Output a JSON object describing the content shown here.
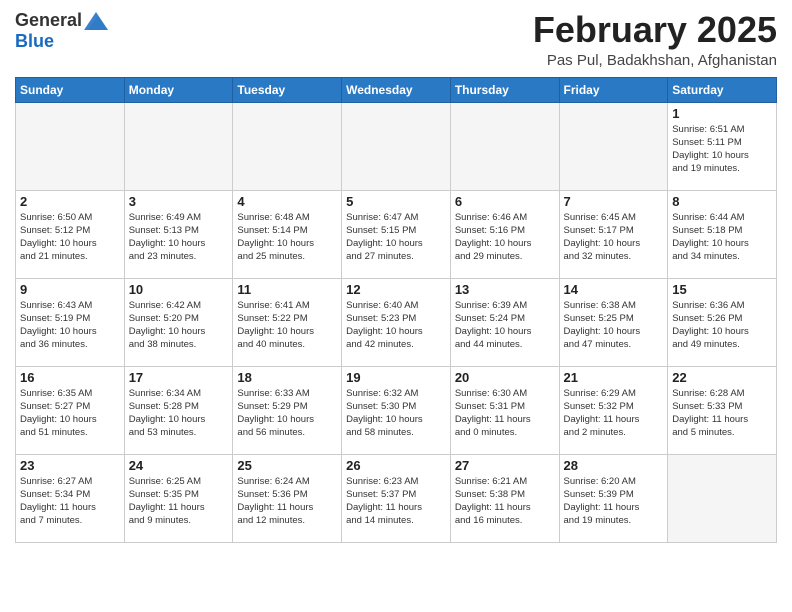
{
  "header": {
    "logo_general": "General",
    "logo_blue": "Blue",
    "title": "February 2025",
    "subtitle": "Pas Pul, Badakhshan, Afghanistan"
  },
  "weekdays": [
    "Sunday",
    "Monday",
    "Tuesday",
    "Wednesday",
    "Thursday",
    "Friday",
    "Saturday"
  ],
  "weeks": [
    [
      {
        "day": "",
        "info": ""
      },
      {
        "day": "",
        "info": ""
      },
      {
        "day": "",
        "info": ""
      },
      {
        "day": "",
        "info": ""
      },
      {
        "day": "",
        "info": ""
      },
      {
        "day": "",
        "info": ""
      },
      {
        "day": "1",
        "info": "Sunrise: 6:51 AM\nSunset: 5:11 PM\nDaylight: 10 hours\nand 19 minutes."
      }
    ],
    [
      {
        "day": "2",
        "info": "Sunrise: 6:50 AM\nSunset: 5:12 PM\nDaylight: 10 hours\nand 21 minutes."
      },
      {
        "day": "3",
        "info": "Sunrise: 6:49 AM\nSunset: 5:13 PM\nDaylight: 10 hours\nand 23 minutes."
      },
      {
        "day": "4",
        "info": "Sunrise: 6:48 AM\nSunset: 5:14 PM\nDaylight: 10 hours\nand 25 minutes."
      },
      {
        "day": "5",
        "info": "Sunrise: 6:47 AM\nSunset: 5:15 PM\nDaylight: 10 hours\nand 27 minutes."
      },
      {
        "day": "6",
        "info": "Sunrise: 6:46 AM\nSunset: 5:16 PM\nDaylight: 10 hours\nand 29 minutes."
      },
      {
        "day": "7",
        "info": "Sunrise: 6:45 AM\nSunset: 5:17 PM\nDaylight: 10 hours\nand 32 minutes."
      },
      {
        "day": "8",
        "info": "Sunrise: 6:44 AM\nSunset: 5:18 PM\nDaylight: 10 hours\nand 34 minutes."
      }
    ],
    [
      {
        "day": "9",
        "info": "Sunrise: 6:43 AM\nSunset: 5:19 PM\nDaylight: 10 hours\nand 36 minutes."
      },
      {
        "day": "10",
        "info": "Sunrise: 6:42 AM\nSunset: 5:20 PM\nDaylight: 10 hours\nand 38 minutes."
      },
      {
        "day": "11",
        "info": "Sunrise: 6:41 AM\nSunset: 5:22 PM\nDaylight: 10 hours\nand 40 minutes."
      },
      {
        "day": "12",
        "info": "Sunrise: 6:40 AM\nSunset: 5:23 PM\nDaylight: 10 hours\nand 42 minutes."
      },
      {
        "day": "13",
        "info": "Sunrise: 6:39 AM\nSunset: 5:24 PM\nDaylight: 10 hours\nand 44 minutes."
      },
      {
        "day": "14",
        "info": "Sunrise: 6:38 AM\nSunset: 5:25 PM\nDaylight: 10 hours\nand 47 minutes."
      },
      {
        "day": "15",
        "info": "Sunrise: 6:36 AM\nSunset: 5:26 PM\nDaylight: 10 hours\nand 49 minutes."
      }
    ],
    [
      {
        "day": "16",
        "info": "Sunrise: 6:35 AM\nSunset: 5:27 PM\nDaylight: 10 hours\nand 51 minutes."
      },
      {
        "day": "17",
        "info": "Sunrise: 6:34 AM\nSunset: 5:28 PM\nDaylight: 10 hours\nand 53 minutes."
      },
      {
        "day": "18",
        "info": "Sunrise: 6:33 AM\nSunset: 5:29 PM\nDaylight: 10 hours\nand 56 minutes."
      },
      {
        "day": "19",
        "info": "Sunrise: 6:32 AM\nSunset: 5:30 PM\nDaylight: 10 hours\nand 58 minutes."
      },
      {
        "day": "20",
        "info": "Sunrise: 6:30 AM\nSunset: 5:31 PM\nDaylight: 11 hours\nand 0 minutes."
      },
      {
        "day": "21",
        "info": "Sunrise: 6:29 AM\nSunset: 5:32 PM\nDaylight: 11 hours\nand 2 minutes."
      },
      {
        "day": "22",
        "info": "Sunrise: 6:28 AM\nSunset: 5:33 PM\nDaylight: 11 hours\nand 5 minutes."
      }
    ],
    [
      {
        "day": "23",
        "info": "Sunrise: 6:27 AM\nSunset: 5:34 PM\nDaylight: 11 hours\nand 7 minutes."
      },
      {
        "day": "24",
        "info": "Sunrise: 6:25 AM\nSunset: 5:35 PM\nDaylight: 11 hours\nand 9 minutes."
      },
      {
        "day": "25",
        "info": "Sunrise: 6:24 AM\nSunset: 5:36 PM\nDaylight: 11 hours\nand 12 minutes."
      },
      {
        "day": "26",
        "info": "Sunrise: 6:23 AM\nSunset: 5:37 PM\nDaylight: 11 hours\nand 14 minutes."
      },
      {
        "day": "27",
        "info": "Sunrise: 6:21 AM\nSunset: 5:38 PM\nDaylight: 11 hours\nand 16 minutes."
      },
      {
        "day": "28",
        "info": "Sunrise: 6:20 AM\nSunset: 5:39 PM\nDaylight: 11 hours\nand 19 minutes."
      },
      {
        "day": "",
        "info": ""
      }
    ]
  ]
}
